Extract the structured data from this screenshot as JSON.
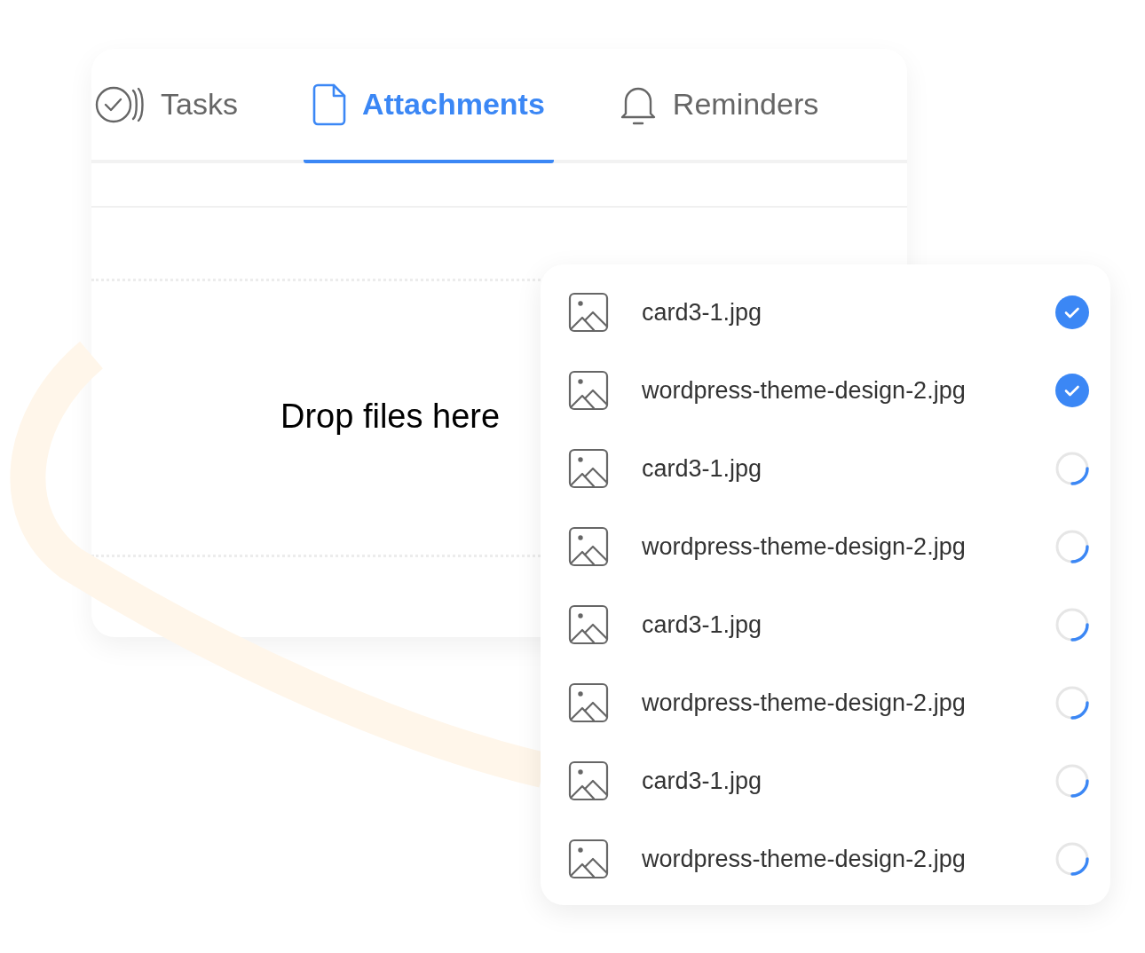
{
  "tabs": [
    {
      "label": "Tasks",
      "kind": "tasks",
      "selected": false
    },
    {
      "label": "Attachments",
      "kind": "file",
      "selected": true
    },
    {
      "label": "Reminders",
      "kind": "bell",
      "selected": false
    }
  ],
  "dropzone": {
    "text": "Drop files here"
  },
  "files": [
    {
      "name": "card3-1.jpg",
      "kind": "done"
    },
    {
      "name": "wordpress-theme-design-2.jpg",
      "kind": "done"
    },
    {
      "name": "card3-1.jpg",
      "kind": "uploading"
    },
    {
      "name": "wordpress-theme-design-2.jpg",
      "kind": "uploading"
    },
    {
      "name": "card3-1.jpg",
      "kind": "uploading"
    },
    {
      "name": "wordpress-theme-design-2.jpg",
      "kind": "uploading"
    },
    {
      "name": "card3-1.jpg",
      "kind": "uploading"
    },
    {
      "name": "wordpress-theme-design-2.jpg",
      "kind": "uploading"
    }
  ]
}
